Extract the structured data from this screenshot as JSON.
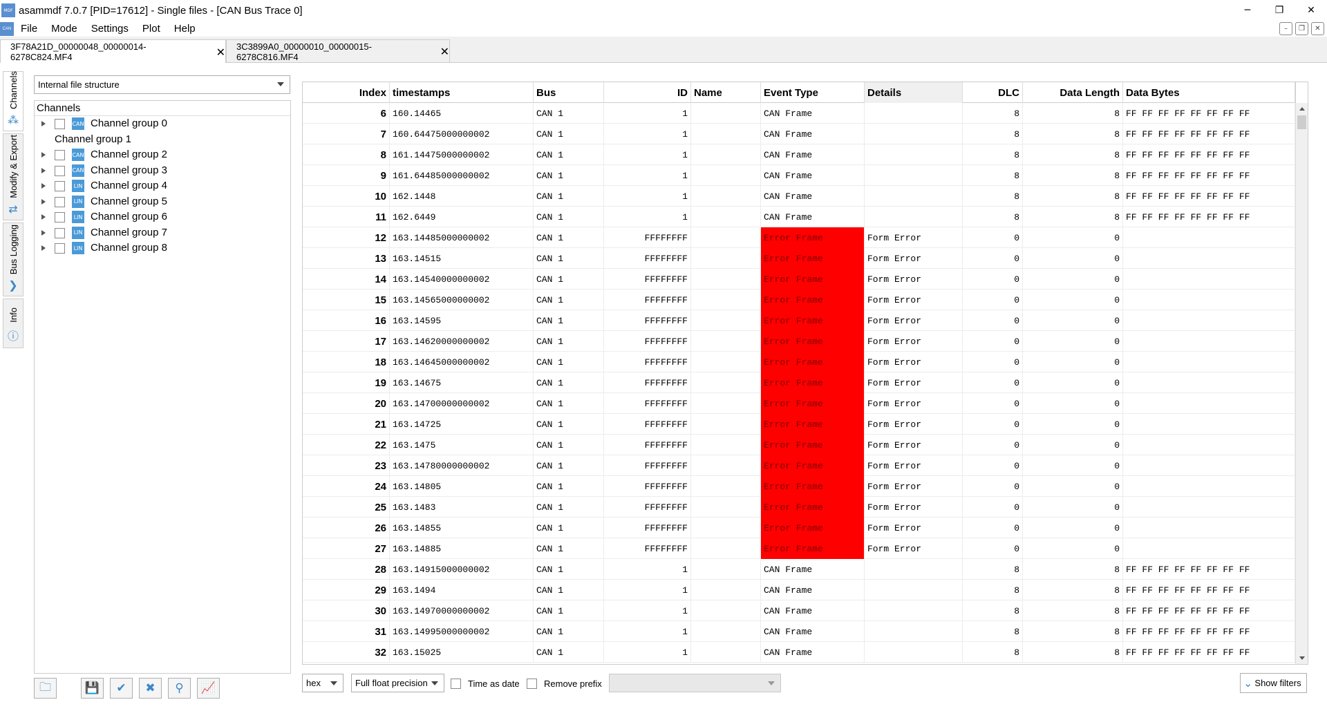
{
  "window": {
    "title": "asammdf 7.0.7 [PID=17612] - Single files - [CAN Bus Trace 0]",
    "minimize": "─",
    "restore": "❐",
    "close": "✕"
  },
  "menu": [
    "File",
    "Mode",
    "Settings",
    "Plot",
    "Help"
  ],
  "tabs": [
    {
      "label": "3F78A21D_00000048_00000014-6278C824.MF4",
      "active": true
    },
    {
      "label": "3C3899A0_00000010_00000015-6278C816.MF4",
      "active": false
    }
  ],
  "side_tabs": [
    "Channels",
    "Modify & Export",
    "Bus Logging",
    "Info"
  ],
  "left_panel": {
    "view_mode": "Internal file structure",
    "tree_header": "Channels",
    "groups": [
      {
        "label": "Channel group 0",
        "expandable": true,
        "checkbox": true,
        "icon": "CAN"
      },
      {
        "label": "Channel group 1",
        "expandable": false,
        "checkbox": false,
        "icon": ""
      },
      {
        "label": "Channel group 2",
        "expandable": true,
        "checkbox": true,
        "icon": "CAN"
      },
      {
        "label": "Channel group 3",
        "expandable": true,
        "checkbox": true,
        "icon": "CAN"
      },
      {
        "label": "Channel group 4",
        "expandable": true,
        "checkbox": true,
        "icon": "LIN"
      },
      {
        "label": "Channel group 5",
        "expandable": true,
        "checkbox": true,
        "icon": "LIN"
      },
      {
        "label": "Channel group 6",
        "expandable": true,
        "checkbox": true,
        "icon": "LIN"
      },
      {
        "label": "Channel group 7",
        "expandable": true,
        "checkbox": true,
        "icon": "LIN"
      },
      {
        "label": "Channel group 8",
        "expandable": true,
        "checkbox": true,
        "icon": "LIN"
      }
    ]
  },
  "table": {
    "columns": [
      "Index",
      "timestamps",
      "Bus",
      "ID",
      "Name",
      "Event Type",
      "Details",
      "DLC",
      "Data Length",
      "Data Bytes"
    ],
    "rows": [
      [
        "6",
        "160.14465",
        "CAN 1",
        "1",
        "",
        "CAN Frame",
        "",
        "8",
        "8",
        "FF FF FF FF FF FF FF FF"
      ],
      [
        "7",
        "160.64475000000002",
        "CAN 1",
        "1",
        "",
        "CAN Frame",
        "",
        "8",
        "8",
        "FF FF FF FF FF FF FF FF"
      ],
      [
        "8",
        "161.14475000000002",
        "CAN 1",
        "1",
        "",
        "CAN Frame",
        "",
        "8",
        "8",
        "FF FF FF FF FF FF FF FF"
      ],
      [
        "9",
        "161.64485000000002",
        "CAN 1",
        "1",
        "",
        "CAN Frame",
        "",
        "8",
        "8",
        "FF FF FF FF FF FF FF FF"
      ],
      [
        "10",
        "162.1448",
        "CAN 1",
        "1",
        "",
        "CAN Frame",
        "",
        "8",
        "8",
        "FF FF FF FF FF FF FF FF"
      ],
      [
        "11",
        "162.6449",
        "CAN 1",
        "1",
        "",
        "CAN Frame",
        "",
        "8",
        "8",
        "FF FF FF FF FF FF FF FF"
      ],
      [
        "12",
        "163.14485000000002",
        "CAN 1",
        "FFFFFFFF",
        "",
        "Error Frame",
        "Form Error",
        "0",
        "0",
        ""
      ],
      [
        "13",
        "163.14515",
        "CAN 1",
        "FFFFFFFF",
        "",
        "Error Frame",
        "Form Error",
        "0",
        "0",
        ""
      ],
      [
        "14",
        "163.14540000000002",
        "CAN 1",
        "FFFFFFFF",
        "",
        "Error Frame",
        "Form Error",
        "0",
        "0",
        ""
      ],
      [
        "15",
        "163.14565000000002",
        "CAN 1",
        "FFFFFFFF",
        "",
        "Error Frame",
        "Form Error",
        "0",
        "0",
        ""
      ],
      [
        "16",
        "163.14595",
        "CAN 1",
        "FFFFFFFF",
        "",
        "Error Frame",
        "Form Error",
        "0",
        "0",
        ""
      ],
      [
        "17",
        "163.14620000000002",
        "CAN 1",
        "FFFFFFFF",
        "",
        "Error Frame",
        "Form Error",
        "0",
        "0",
        ""
      ],
      [
        "18",
        "163.14645000000002",
        "CAN 1",
        "FFFFFFFF",
        "",
        "Error Frame",
        "Form Error",
        "0",
        "0",
        ""
      ],
      [
        "19",
        "163.14675",
        "CAN 1",
        "FFFFFFFF",
        "",
        "Error Frame",
        "Form Error",
        "0",
        "0",
        ""
      ],
      [
        "20",
        "163.14700000000002",
        "CAN 1",
        "FFFFFFFF",
        "",
        "Error Frame",
        "Form Error",
        "0",
        "0",
        ""
      ],
      [
        "21",
        "163.14725",
        "CAN 1",
        "FFFFFFFF",
        "",
        "Error Frame",
        "Form Error",
        "0",
        "0",
        ""
      ],
      [
        "22",
        "163.1475",
        "CAN 1",
        "FFFFFFFF",
        "",
        "Error Frame",
        "Form Error",
        "0",
        "0",
        ""
      ],
      [
        "23",
        "163.14780000000002",
        "CAN 1",
        "FFFFFFFF",
        "",
        "Error Frame",
        "Form Error",
        "0",
        "0",
        ""
      ],
      [
        "24",
        "163.14805",
        "CAN 1",
        "FFFFFFFF",
        "",
        "Error Frame",
        "Form Error",
        "0",
        "0",
        ""
      ],
      [
        "25",
        "163.1483",
        "CAN 1",
        "FFFFFFFF",
        "",
        "Error Frame",
        "Form Error",
        "0",
        "0",
        ""
      ],
      [
        "26",
        "163.14855",
        "CAN 1",
        "FFFFFFFF",
        "",
        "Error Frame",
        "Form Error",
        "0",
        "0",
        ""
      ],
      [
        "27",
        "163.14885",
        "CAN 1",
        "FFFFFFFF",
        "",
        "Error Frame",
        "Form Error",
        "0",
        "0",
        ""
      ],
      [
        "28",
        "163.14915000000002",
        "CAN 1",
        "1",
        "",
        "CAN Frame",
        "",
        "8",
        "8",
        "FF FF FF FF FF FF FF FF"
      ],
      [
        "29",
        "163.1494",
        "CAN 1",
        "1",
        "",
        "CAN Frame",
        "",
        "8",
        "8",
        "FF FF FF FF FF FF FF FF"
      ],
      [
        "30",
        "163.14970000000002",
        "CAN 1",
        "1",
        "",
        "CAN Frame",
        "",
        "8",
        "8",
        "FF FF FF FF FF FF FF FF"
      ],
      [
        "31",
        "163.14995000000002",
        "CAN 1",
        "1",
        "",
        "CAN Frame",
        "",
        "8",
        "8",
        "FF FF FF FF FF FF FF FF"
      ],
      [
        "32",
        "163.15025",
        "CAN 1",
        "1",
        "",
        "CAN Frame",
        "",
        "8",
        "8",
        "FF FF FF FF FF FF FF FF"
      ]
    ],
    "error_color": "#ff0000"
  },
  "bottom": {
    "format": "hex",
    "precision": "Full float precision",
    "time_as_date": "Time as date",
    "remove_prefix": "Remove prefix",
    "filter_combo": "",
    "show_filters": "Show filters"
  },
  "toolbar_icons": [
    "open-file-icon",
    "save-icon",
    "check-all-icon",
    "uncheck-all-icon",
    "search-icon",
    "plot-icon"
  ]
}
